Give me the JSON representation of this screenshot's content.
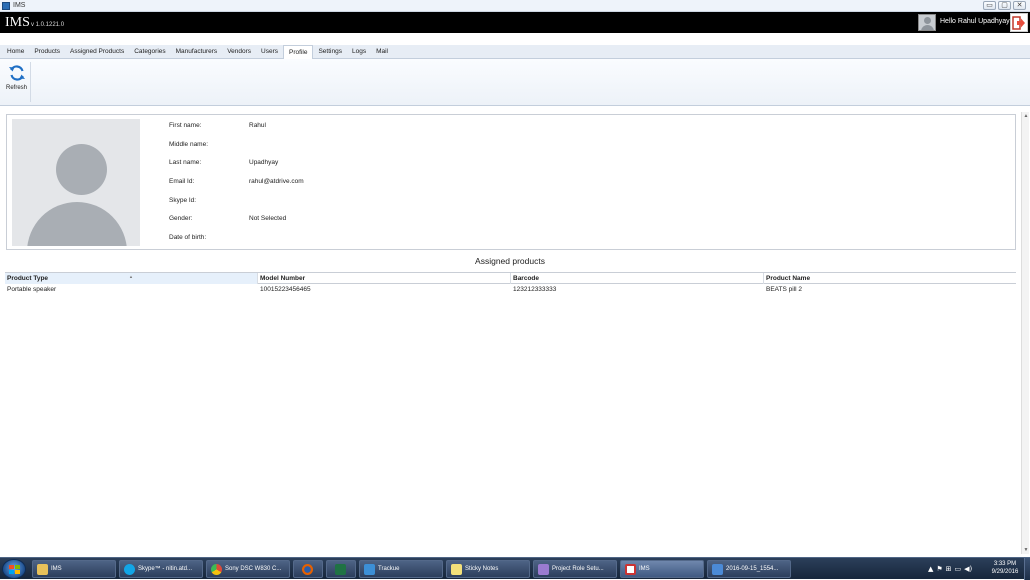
{
  "window": {
    "title": "IMS",
    "controls": {
      "minimize": "▭",
      "maximize": "▢",
      "close": "✕"
    }
  },
  "header": {
    "brand": "IMS",
    "version": "v 1.0.1221.0",
    "greeting": "Hello Rahul Upadhyay"
  },
  "tabs": [
    {
      "label": "Home"
    },
    {
      "label": "Products"
    },
    {
      "label": "Assigned Products"
    },
    {
      "label": "Categories"
    },
    {
      "label": "Manufacturers"
    },
    {
      "label": "Vendors"
    },
    {
      "label": "Users"
    },
    {
      "label": "Profile",
      "active": true
    },
    {
      "label": "Settings"
    },
    {
      "label": "Logs"
    },
    {
      "label": "Mail"
    }
  ],
  "ribbon": {
    "refresh_label": "Refresh"
  },
  "profile": {
    "fields": [
      {
        "label": "First name:",
        "value": "Rahul"
      },
      {
        "label": "Middle name:",
        "value": ""
      },
      {
        "label": "Last name:",
        "value": "Upadhyay"
      },
      {
        "label": "Email Id:",
        "value": "rahul@atdrive.com"
      },
      {
        "label": "Skype Id:",
        "value": ""
      },
      {
        "label": "Gender:",
        "value": "Not Selected"
      },
      {
        "label": "Date of birth:",
        "value": ""
      }
    ]
  },
  "assigned": {
    "title": "Assigned products",
    "columns": [
      "Product Type",
      "Model Number",
      "Barcode",
      "Product Name"
    ],
    "rows": [
      [
        "Portable speaker",
        "10015223456465",
        "123212333333",
        "BEATS pill 2"
      ]
    ]
  },
  "taskbar": {
    "items": [
      {
        "label": "IMS",
        "icon": "folder-icon",
        "color": "#e8c15a"
      },
      {
        "label": "Skype™ - nitin.atd...",
        "icon": "skype-icon",
        "color": "#12a5e6"
      },
      {
        "label": "Sony DSC W830 C...",
        "icon": "chrome-icon",
        "color": "#dd4b39"
      },
      {
        "label": "",
        "icon": "firefox-icon",
        "color": "#e66000"
      },
      {
        "label": "",
        "icon": "excel-icon",
        "color": "#1f7244"
      },
      {
        "label": "Trackue",
        "icon": "trackue-icon",
        "color": "#3c8fd6"
      },
      {
        "label": "Sticky Notes",
        "icon": "sticky-notes-icon",
        "color": "#f3e07a"
      },
      {
        "label": "Project Role Setu...",
        "icon": "visual-studio-icon",
        "color": "#9b7bd0"
      },
      {
        "label": "IMS",
        "icon": "ims-window-icon",
        "color": "#c33",
        "active": true
      },
      {
        "label": "2016-09-15_1554...",
        "icon": "image-viewer-icon",
        "color": "#4b8ad6"
      }
    ],
    "tray": [
      "▲",
      "⚑",
      "⊞",
      "▭",
      "◀)"
    ],
    "time": "3:33 PM",
    "date": "9/29/2016"
  }
}
